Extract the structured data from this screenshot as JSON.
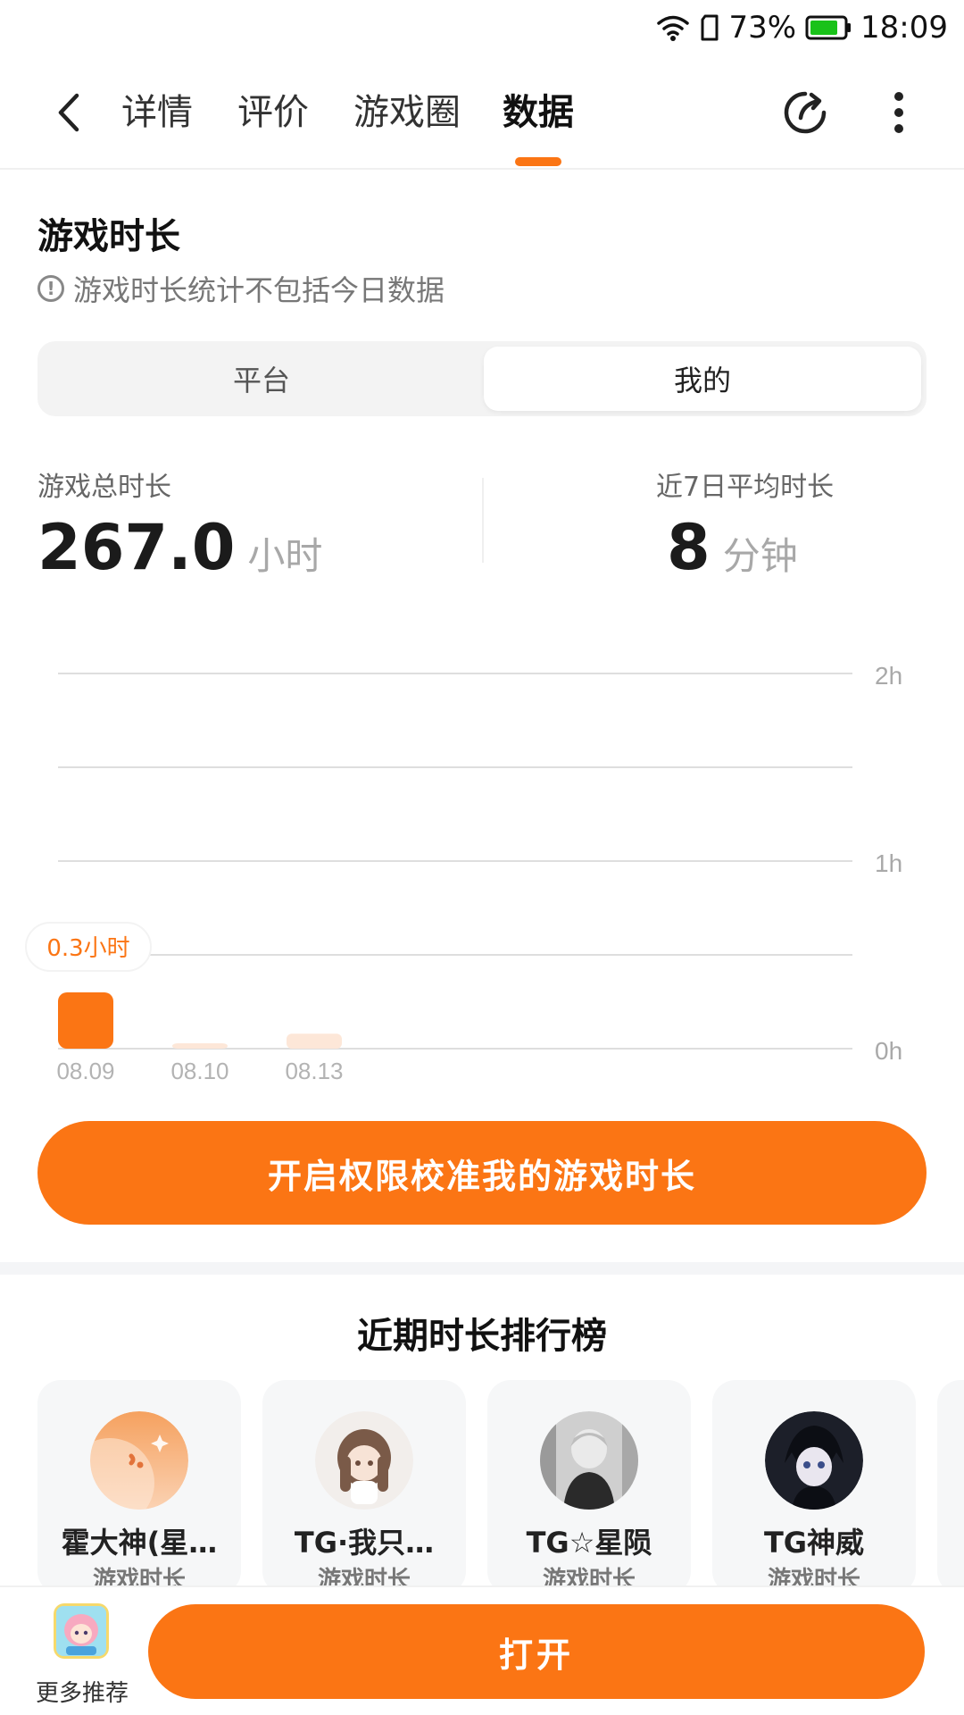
{
  "status_bar": {
    "battery": "73%",
    "time": "18:09"
  },
  "nav": {
    "tabs": [
      {
        "label": "详情"
      },
      {
        "label": "评价"
      },
      {
        "label": "游戏圈"
      },
      {
        "label": "数据"
      }
    ],
    "active_tab": "数据"
  },
  "playtime": {
    "title": "游戏时长",
    "notice": "游戏时长统计不包括今日数据",
    "toggle": {
      "left": "平台",
      "right": "我的",
      "selected": "我的"
    },
    "total": {
      "label": "游戏总时长",
      "value": "267.0",
      "unit": "小时"
    },
    "avg7": {
      "label": "近7日平均时长",
      "value": "8",
      "unit": "分钟"
    }
  },
  "chart_data": {
    "type": "bar",
    "categories": [
      "08.09",
      "08.10",
      "08.13"
    ],
    "values": [
      0.3,
      0.02,
      0.08
    ],
    "y_ticks": [
      "0h",
      "1h",
      "2h"
    ],
    "ylim": [
      0,
      2
    ],
    "tooltip": "0.3小时",
    "highlight_color": "#fb7514",
    "muted_color": "#fde7d8"
  },
  "cta": {
    "label": "开启权限校准我的游戏时长"
  },
  "ranking": {
    "title": "近期时长排行榜",
    "items": [
      {
        "name": "霍大神(星…",
        "sub": "游戏时长"
      },
      {
        "name": "TG·我只…",
        "sub": "游戏时长"
      },
      {
        "name": "TG☆星陨",
        "sub": "游戏时长"
      },
      {
        "name": "TG神威",
        "sub": "游戏时长"
      }
    ]
  },
  "bottom": {
    "more_label": "更多推荐",
    "open_label": "打开"
  },
  "colors": {
    "accent": "#fb7514"
  }
}
